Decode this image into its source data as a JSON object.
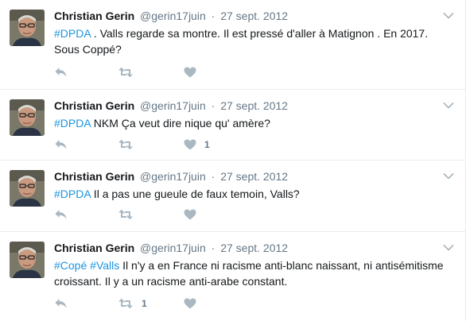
{
  "icons": {
    "avatar": "avatar-photo",
    "caret": "chevron-down-icon",
    "reply": "reply-icon",
    "retweet": "retweet-icon",
    "like": "heart-icon"
  },
  "colors": {
    "hashtag": "#1b95e0",
    "icon": "#aab8c2",
    "secondary_text": "#657786"
  },
  "tweets": [
    {
      "fullname": "Christian Gerin",
      "username": "@gerin17juin",
      "separator": "·",
      "time": "27 sept. 2012",
      "hashtags": [
        "#DPDA"
      ],
      "text": " . Valls regarde sa montre. Il est pressé d'aller à Matignon . En 2017. Sous Coppé?",
      "retweet_count": "",
      "like_count": ""
    },
    {
      "fullname": "Christian Gerin",
      "username": "@gerin17juin",
      "separator": "·",
      "time": "27 sept. 2012",
      "hashtags": [
        "#DPDA"
      ],
      "text": " NKM  Ça veut dire nique qu' amère?",
      "retweet_count": "",
      "like_count": "1"
    },
    {
      "fullname": "Christian Gerin",
      "username": "@gerin17juin",
      "separator": "·",
      "time": "27 sept. 2012",
      "hashtags": [
        "#DPDA"
      ],
      "text": "  Il a pas une gueule de faux temoin, Valls?",
      "retweet_count": "",
      "like_count": ""
    },
    {
      "fullname": "Christian Gerin",
      "username": "@gerin17juin",
      "separator": "·",
      "time": "27 sept. 2012",
      "hashtags": [
        "#Copé",
        "#Valls"
      ],
      "text": "  Il n'y a en France ni racisme anti-blanc naissant, ni antisémitisme croissant. Il y a un racisme anti-arabe constant.",
      "retweet_count": "1",
      "like_count": ""
    }
  ]
}
